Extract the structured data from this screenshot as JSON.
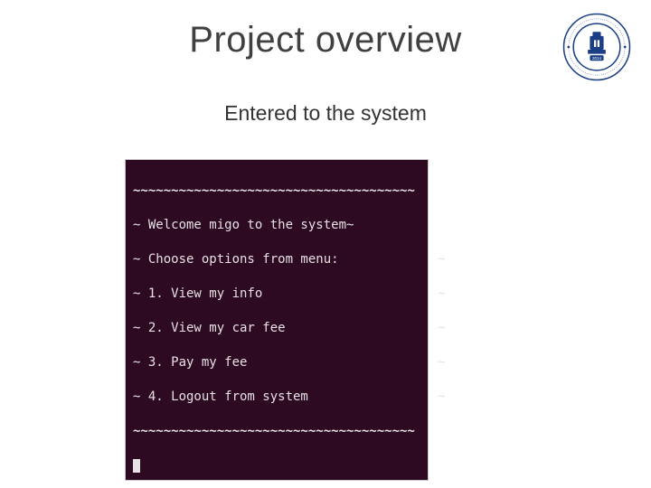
{
  "title": "Project overview",
  "subtitle": "Entered to the system",
  "logo": {
    "name": "university-seal-icon",
    "inner_year": "2014",
    "ring_color": "#1b3f86",
    "outer_text_top": "INHA UNIVERSITY IN TASHKENT",
    "outer_text_bottom": "TOSHKENT SHAHRIDAGI INHA UNIVERSITETI"
  },
  "terminal": {
    "border_top": "~~~~~~~~~~~~~~~~~~~~~~~~~~~~~~~~~~~~~",
    "lines": [
      "~ Welcome migo to the system~",
      "~ Choose options from menu:             ~",
      "~ 1. View my info                       ~",
      "~ 2. View my car fee                    ~",
      "~ 3. Pay my fee                         ~",
      "~ 4. Logout from system                 ~"
    ],
    "border_bottom": "~~~~~~~~~~~~~~~~~~~~~~~~~~~~~~~~~~~~~"
  }
}
